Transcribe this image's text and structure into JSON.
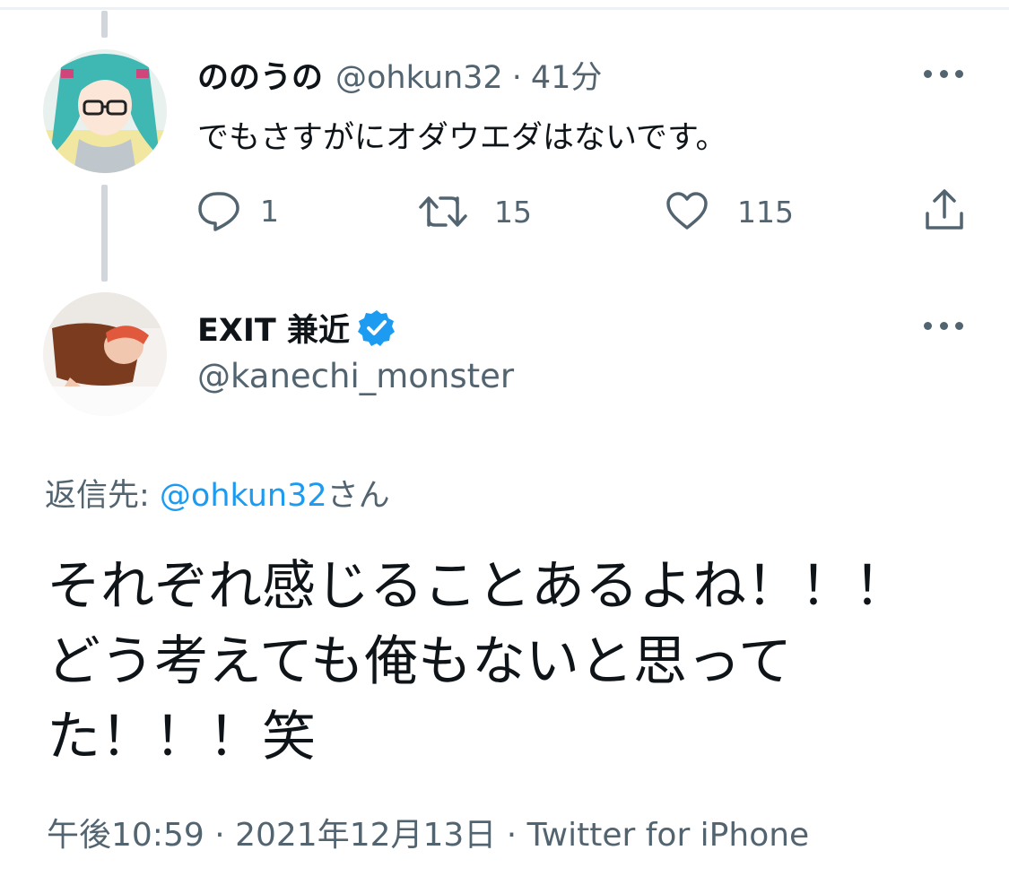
{
  "reply_tweet": {
    "display_name": "ののうの",
    "handle": "@ohkun32",
    "separator": "·",
    "time": "41分",
    "text": "でもさすがにオダウエダはないです。",
    "actions": {
      "reply_count": "1",
      "retweet_count": "15",
      "like_count": "115"
    }
  },
  "main_tweet": {
    "display_name": "EXIT 兼近",
    "handle": "@kanechi_monster",
    "reply_to_label": "返信先: ",
    "reply_to_handle": "@ohkun32",
    "reply_to_suffix": "さん",
    "text_lines": [
      "それぞれ感じることあるよね！！！",
      "どう考えても俺もないと思って",
      "た！！！笑"
    ],
    "meta": "午後10:59 · 2021年12月13日 · Twitter for iPhone"
  },
  "colors": {
    "accent": "#1d9bf0",
    "secondary_text": "#536471",
    "primary_text": "#0f1419"
  }
}
